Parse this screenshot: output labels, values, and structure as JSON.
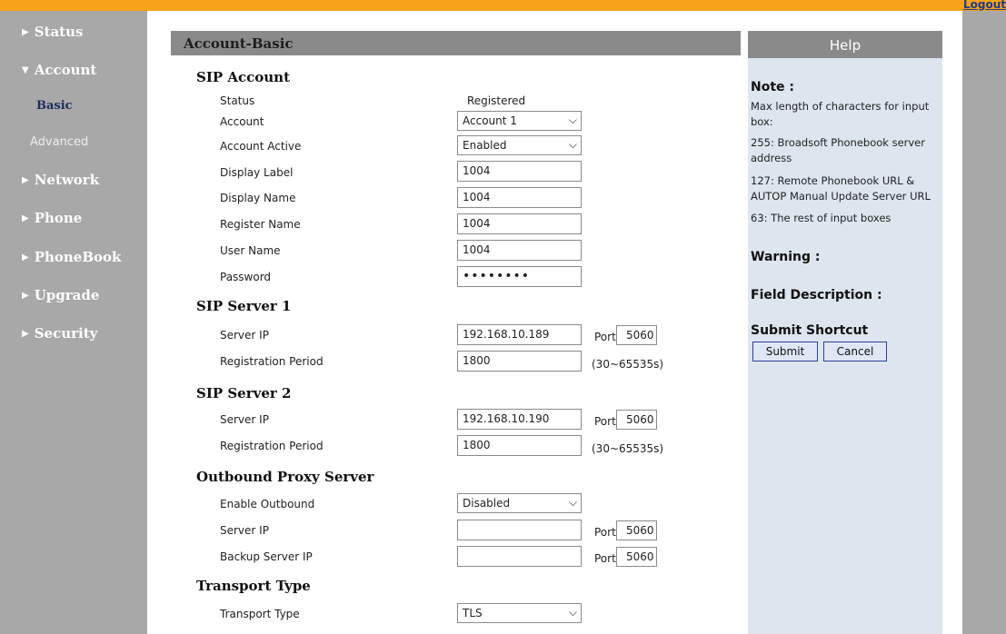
{
  "header": {
    "logout_label": "Logout"
  },
  "sidebar": {
    "items": [
      {
        "label": "Status"
      },
      {
        "label": "Account"
      },
      {
        "label": "Network"
      },
      {
        "label": "Phone"
      },
      {
        "label": "PhoneBook"
      },
      {
        "label": "Upgrade"
      },
      {
        "label": "Security"
      }
    ],
    "account_sub": [
      {
        "label": "Basic",
        "active": true
      },
      {
        "label": "Advanced",
        "active": false
      }
    ]
  },
  "panel": {
    "title": "Account-Basic"
  },
  "sip_account": {
    "title": "SIP Account",
    "status_label": "Status",
    "status_value": "Registered",
    "account_label": "Account",
    "account_value": "Account 1",
    "account_active_label": "Account Active",
    "account_active_value": "Enabled",
    "display_label_label": "Display Label",
    "display_label_value": "1004",
    "display_name_label": "Display Name",
    "display_name_value": "1004",
    "register_name_label": "Register Name",
    "register_name_value": "1004",
    "user_name_label": "User Name",
    "user_name_value": "1004",
    "password_label": "Password",
    "password_value": "••••••••"
  },
  "sip_server_1": {
    "title": "SIP Server 1",
    "server_ip_label": "Server IP",
    "server_ip_value": "192.168.10.189",
    "port_label": "Port",
    "port_value": "5060",
    "reg_period_label": "Registration Period",
    "reg_period_value": "1800",
    "reg_range": "(30~65535s)"
  },
  "sip_server_2": {
    "title": "SIP Server 2",
    "server_ip_label": "Server IP",
    "server_ip_value": "192.168.10.190",
    "port_label": "Port",
    "port_value": "5060",
    "reg_period_label": "Registration Period",
    "reg_period_value": "1800",
    "reg_range": "(30~65535s)"
  },
  "outbound": {
    "title": "Outbound Proxy Server",
    "enable_label": "Enable Outbound",
    "enable_value": "Disabled",
    "server_ip_label": "Server IP",
    "server_ip_value": "",
    "port_label": "Port",
    "port_value": "5060",
    "backup_ip_label": "Backup Server IP",
    "backup_ip_value": "",
    "backup_port_label": "Port",
    "backup_port_value": "5060"
  },
  "transport": {
    "title": "Transport Type",
    "type_label": "Transport Type",
    "type_value": "TLS"
  },
  "help": {
    "title": "Help",
    "note_title": "Note :",
    "note_line1": "Max length of characters for input box:",
    "note_line2": "255: Broadsoft Phonebook server address",
    "note_line3": "127: Remote Phonebook URL & AUTOP Manual Update Server URL",
    "note_line4": "63: The rest of input boxes",
    "warning_title": "Warning :",
    "field_desc_title": "Field Description :",
    "shortcut_title": "Submit Shortcut",
    "submit_label": "Submit",
    "cancel_label": "Cancel"
  },
  "icons": {
    "collapsed": "triangle-right-icon",
    "expanded": "triangle-down-icon",
    "dropdown": "chevron-down-icon"
  },
  "colors": {
    "topbar": "#f5a31a",
    "sidebar": "#a8a8a8",
    "panel_header": "#8a8a8a",
    "help_background": "#dde6ee",
    "button_border": "#2b3f9a"
  }
}
